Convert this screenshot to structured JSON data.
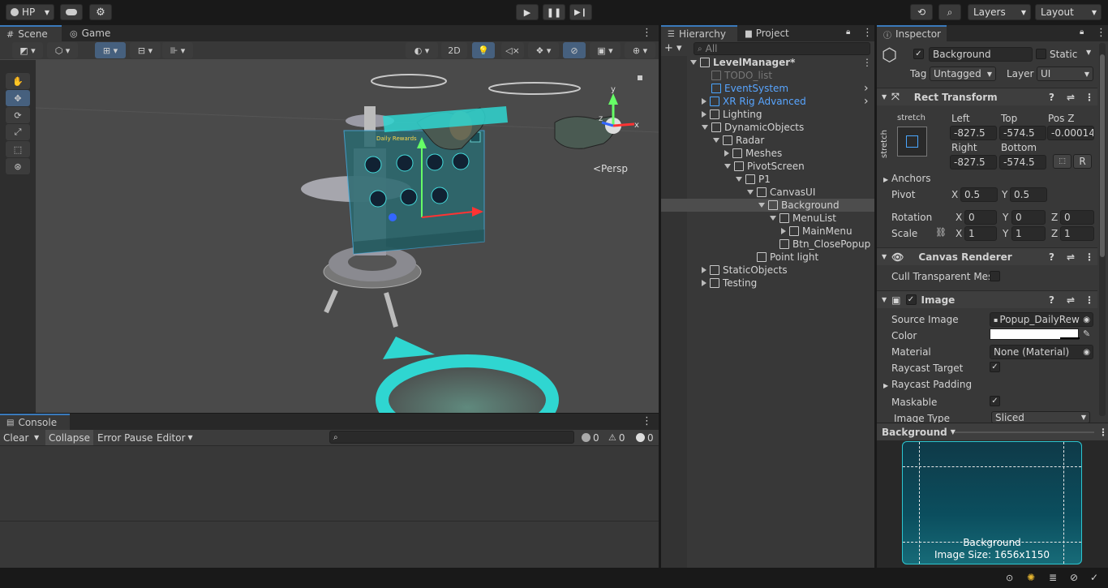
{
  "toolbar": {
    "account": "HP",
    "layers": "Layers",
    "layout": "Layout"
  },
  "scene": {
    "tab_scene": "Scene",
    "tab_game": "Game",
    "btn_2d": "2D",
    "persp": "<Persp",
    "gizmo_y": "y",
    "gizmo_x": "x",
    "gizmo_z": "z",
    "popup_title": "Daily Rewards"
  },
  "console": {
    "tab": "Console",
    "clear": "Clear",
    "collapse": "Collapse",
    "error_pause": "Error Pause",
    "editor": "Editor",
    "count_info": "0",
    "count_warn": "0",
    "count_error": "0"
  },
  "hierarchy": {
    "tab": "Hierarchy",
    "search_placeholder": "All",
    "items": [
      {
        "label": "LevelManager*",
        "depth": 0,
        "arrow": "open",
        "icon": "scene",
        "bold": true
      },
      {
        "label": "TODO_list",
        "depth": 1,
        "arrow": "",
        "icon": "cube",
        "dim": true
      },
      {
        "label": "EventSystem",
        "depth": 1,
        "arrow": "",
        "icon": "cube-blue",
        "blue": true
      },
      {
        "label": "XR Rig Advanced",
        "depth": 1,
        "arrow": "closed",
        "icon": "cube-blue",
        "blue": true
      },
      {
        "label": "Lighting",
        "depth": 1,
        "arrow": "closed",
        "icon": "cube"
      },
      {
        "label": "DynamicObjects",
        "depth": 1,
        "arrow": "open",
        "icon": "cube"
      },
      {
        "label": "Radar",
        "depth": 2,
        "arrow": "open",
        "icon": "cube"
      },
      {
        "label": "Meshes",
        "depth": 3,
        "arrow": "closed",
        "icon": "cube"
      },
      {
        "label": "PivotScreen",
        "depth": 3,
        "arrow": "open",
        "icon": "cube"
      },
      {
        "label": "P1",
        "depth": 4,
        "arrow": "open",
        "icon": "cube"
      },
      {
        "label": "CanvasUI",
        "depth": 5,
        "arrow": "open",
        "icon": "cube"
      },
      {
        "label": "Background",
        "depth": 6,
        "arrow": "open",
        "icon": "cube",
        "selected": true
      },
      {
        "label": "MenuList",
        "depth": 7,
        "arrow": "open",
        "icon": "cube"
      },
      {
        "label": "MainMenu",
        "depth": 8,
        "arrow": "closed",
        "icon": "cube"
      },
      {
        "label": "Btn_ClosePopup",
        "depth": 7,
        "arrow": "",
        "icon": "cube"
      },
      {
        "label": "Point light",
        "depth": 5,
        "arrow": "",
        "icon": "cube"
      },
      {
        "label": "StaticObjects",
        "depth": 1,
        "arrow": "closed",
        "icon": "cube"
      },
      {
        "label": "Testing",
        "depth": 1,
        "arrow": "closed",
        "icon": "cube"
      }
    ]
  },
  "project": {
    "tab": "Project"
  },
  "inspector": {
    "tab": "Inspector",
    "object_name": "Background",
    "static_label": "Static",
    "tag_label": "Tag",
    "tag_value": "Untagged",
    "layer_label": "Layer",
    "layer_value": "UI",
    "rect_transform": {
      "title": "Rect Transform",
      "anchor_h": "stretch",
      "anchor_v": "stretch",
      "left_label": "Left",
      "top_label": "Top",
      "posz_label": "Pos Z",
      "right_label": "Right",
      "bottom_label": "Bottom",
      "left": "-827.5",
      "top": "-574.5",
      "posz": "-0.00014",
      "right": "-827.5",
      "bottom": "-574.5",
      "r_btn": "R",
      "anchors": "Anchors",
      "pivot": "Pivot",
      "pivot_x": "0.5",
      "pivot_y": "0.5",
      "rotation": "Rotation",
      "rot_x": "0",
      "rot_y": "0",
      "rot_z": "0",
      "scale": "Scale",
      "scale_x": "1",
      "scale_y": "1",
      "scale_z": "1",
      "axis_x": "X",
      "axis_y": "Y",
      "axis_z": "Z"
    },
    "canvas_renderer": {
      "title": "Canvas Renderer",
      "cull_label": "Cull Transparent Mes"
    },
    "image": {
      "title": "Image",
      "source_label": "Source Image",
      "source_value": "Popup_DailyRew",
      "color_label": "Color",
      "material_label": "Material",
      "material_value": "None (Material)",
      "raycast_target": "Raycast Target",
      "raycast_padding": "Raycast Padding",
      "maskable": "Maskable",
      "image_type_label": "Image Type",
      "image_type_value": "Sliced"
    },
    "preview": {
      "title": "Background",
      "name": "Background",
      "size": "Image Size: 1656x1150"
    }
  },
  "colors": {
    "accent": "#3a79bb",
    "selected_row": "#4d4d4d",
    "blue_text": "#58a5ff",
    "teal": "#2fd6d1"
  }
}
